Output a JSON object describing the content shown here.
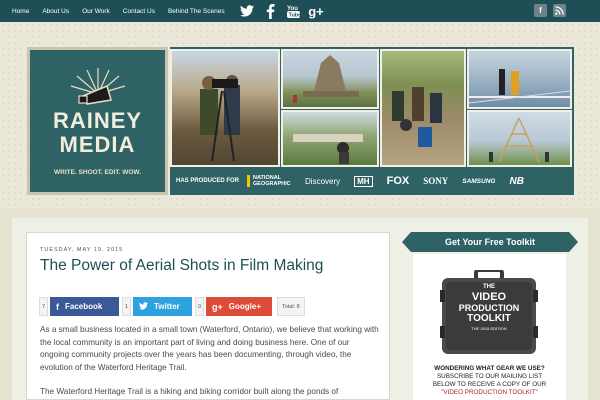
{
  "nav": {
    "links": [
      "Home",
      "About Us",
      "Our Work",
      "Contact Us",
      "Behind The Scenes"
    ],
    "social_icons": [
      "twitter-icon",
      "facebook-icon",
      "youtube-icon",
      "google-plus-icon"
    ],
    "right_icons": [
      "facebook-square-icon",
      "rss-icon"
    ]
  },
  "header": {
    "logo_line1": "RAINEY",
    "logo_line2": "MEDIA",
    "logo_tagline": "WRITE. SHOOT. EDIT. WOW.",
    "has_produced_label": "HAS PRODUCED FOR",
    "brands": [
      "NATIONAL GEOGRAPHIC",
      "Discovery",
      "MH",
      "FOX",
      "SONY",
      "SAMSUNG",
      "NB"
    ]
  },
  "post": {
    "date": "TUESDAY, MAY 19, 2015",
    "title": "The Power of Aerial Shots in Film Making",
    "share": {
      "facebook_count": "7",
      "facebook_label": "Facebook",
      "twitter_count": "1",
      "twitter_label": "Twitter",
      "google_count": "0",
      "google_label": "Google+",
      "total": "Total: 8"
    },
    "paragraph1": "As a small business located in a small town (Waterford, Ontario), we believe that working with the local community is an important part of living and doing business here.  One of our ongoing community projects over the years has been documenting, through video, the evolution of the Waterford Heritage Trail.",
    "paragraph2": "The Waterford Heritage Trail is a hiking and biking corridor built along the ponds of"
  },
  "sidebar": {
    "ribbon_title": "Get Your Free Toolkit",
    "case_line1": "THE",
    "case_line2": "VIDEO",
    "case_line3": "PRODUCTION",
    "case_line4": "TOOLKIT",
    "case_line5": "THE 2015 EDITION",
    "cta_heading": "WONDERING WHAT GEAR WE USE?",
    "cta_line2": "SUBSCRIBE TO OUR MAILING LIST",
    "cta_line3": "BELOW TO RECEIVE A COPY OF OUR",
    "cta_line4": "\"VIDEO PRODUCTION TOOLKIT\""
  },
  "colors": {
    "nav_bg": "#1f4f56",
    "accent": "#2f6264",
    "facebook": "#3b5998",
    "twitter": "#2ea2e0",
    "google_plus": "#dd4b39"
  }
}
